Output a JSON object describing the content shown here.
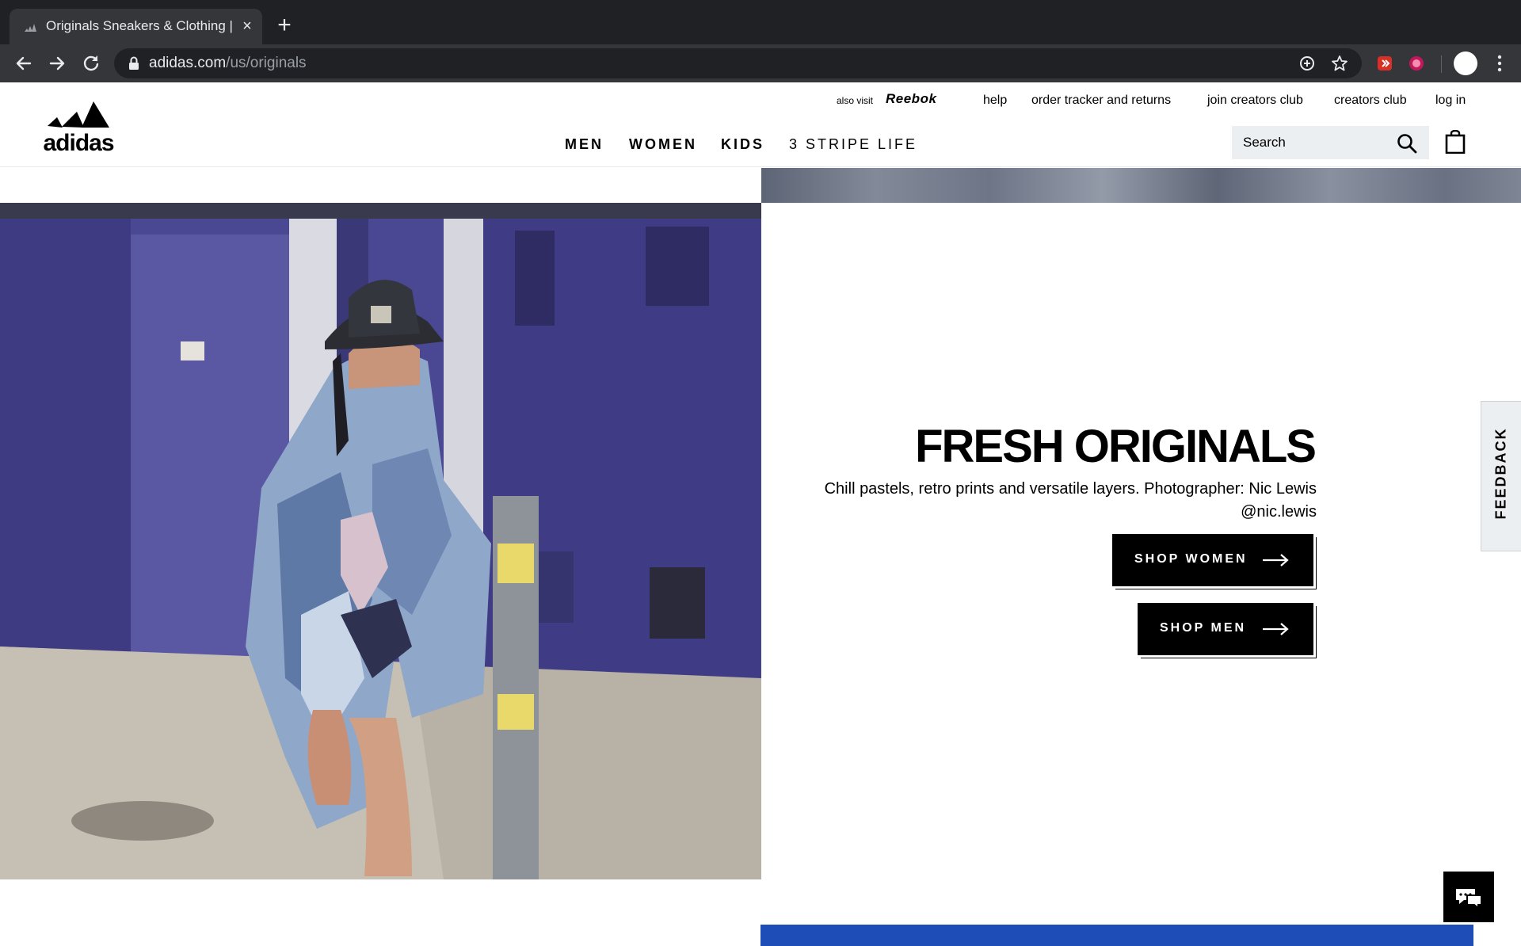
{
  "browser": {
    "tab_title": "Originals Sneakers & Clothing |",
    "tab_close": "×",
    "new_tab": "+",
    "url_domain": "adidas.com",
    "url_path": "/us/originals"
  },
  "header": {
    "also_visit": "also visit",
    "reebok": "Reebok",
    "utility_links": [
      "help",
      "order tracker and returns",
      "join creators club",
      "creators club",
      "log in"
    ],
    "logo_text": "adidas",
    "nav": [
      "MEN",
      "WOMEN",
      "KIDS",
      "3 STRIPE LIFE"
    ],
    "search_placeholder": "Search"
  },
  "hero": {
    "headline": "FRESH ORIGINALS",
    "description": "Chill pastels, retro prints and versatile layers. Photographer: Nic Lewis @nic.lewis",
    "buttons": [
      "SHOP WOMEN",
      "SHOP MEN"
    ]
  },
  "feedback": "FEEDBACK",
  "colors": {
    "chrome_dark": "#202124",
    "chrome_tab": "#35363a",
    "wall_purple": "#4a4793",
    "bottom_blue": "#1e4db7"
  }
}
